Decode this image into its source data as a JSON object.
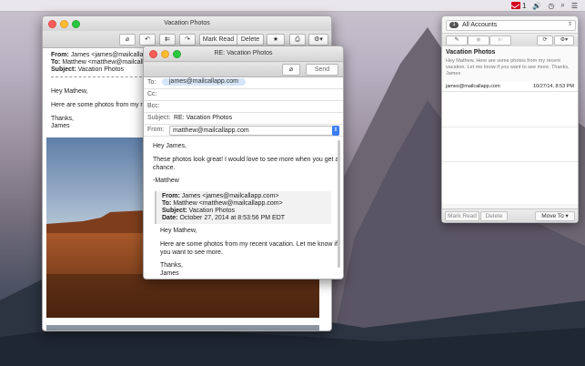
{
  "menubar": {
    "apple": "",
    "mail_count": "1",
    "icons": [
      "mailbutler-icon",
      "volume-icon",
      "time-machine-icon",
      "search-icon",
      "notification-center-icon"
    ]
  },
  "read_window": {
    "title": "Vacation Photos",
    "toolbar": {
      "mark_read": "Mark Read",
      "delete": "Delete"
    },
    "header": {
      "from_label": "From:",
      "from_value": "James <james@mailcallapp.",
      "to_label": "To:",
      "to_value": "Matthew <matthew@mailcallapp",
      "subject_label": "Subject:",
      "subject_value": "Vacation Photos"
    },
    "body": {
      "greeting": "Hey Mathew,",
      "line1": "Here are some photos from my recent",
      "thanks": "Thanks,",
      "signature": "James"
    }
  },
  "reply_window": {
    "title": "RE: Vacation Photos",
    "send": "Send",
    "to_label": "To:",
    "to_value": "james@mailcallapp.com",
    "cc_label": "Cc:",
    "bcc_label": "Bcc:",
    "subject_label": "Subject:",
    "subject_value": "RE: Vacation Photos",
    "from_label": "From:",
    "from_value": "matthew@mailcallapp.com",
    "body": {
      "greeting": "Hey James,",
      "p1_l1": "These photos look great! I would love to see more when you get a",
      "p1_l2": "chance.",
      "sign": "-Matthew"
    },
    "quote": {
      "from_label": "From:",
      "from_value": "James <james@mailcallapp.com>",
      "to_label": "To:",
      "to_value": "Matthew <matthew@mailcallapp.com>",
      "subject_label": "Subject:",
      "subject_value": "Vacation Photos",
      "date_label": "Date:",
      "date_value": "October 27, 2014 at 8:53:56 PM EDT"
    },
    "quoted_body": {
      "greeting": "Hey Mathew,",
      "l1": "Here are some photos from my recent vacation. Let me know if",
      "l2": "you want to see more.",
      "thanks": "Thanks,",
      "sign": "James"
    }
  },
  "panel": {
    "accounts_count": "1",
    "accounts_label": "All Accounts",
    "message": {
      "subject": "Vacation Photos",
      "preview": "Hey Mathew, Here are some photos from my recent vacation. Let me know if you want to see more. Thanks, James",
      "sender": "james@mailcallapp.com",
      "date": "10/27/14, 8:53 PM"
    },
    "bottom": {
      "mark_read": "Mark Read",
      "delete": "Delete",
      "move_to": "Move To"
    }
  }
}
